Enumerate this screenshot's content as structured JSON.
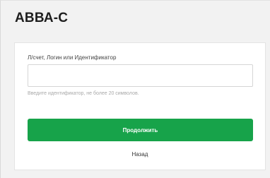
{
  "brand": {
    "title": "АВВА-С"
  },
  "login_form": {
    "field_label": "Л/счет, Логин или Идентификатор",
    "input_value": "",
    "input_placeholder": "",
    "hint": "Введите идентификатор, не более 20 символов.",
    "continue_label": "Продолжить",
    "back_label": "Назад"
  },
  "colors": {
    "accent_green": "#17a34a",
    "page_background": "#f2f2f2",
    "card_background": "#ffffff"
  }
}
